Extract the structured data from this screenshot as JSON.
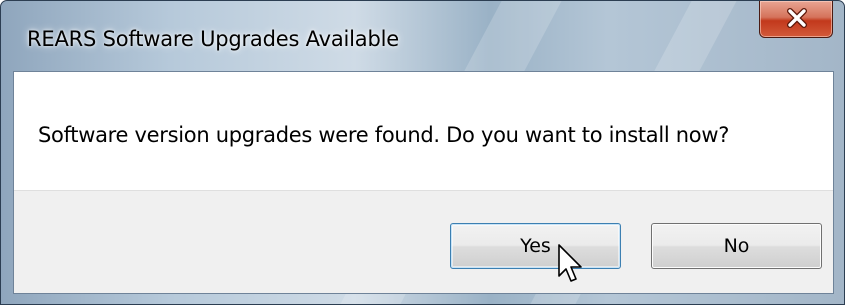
{
  "window": {
    "title": "REARS Software Upgrades Available"
  },
  "title_bar": {
    "close_icon": "close-icon",
    "close_button_color": "#c94a2c"
  },
  "dialog": {
    "message": "Software version upgrades were found.  Do you want to install now?",
    "buttons": {
      "yes_label": "Yes",
      "no_label": "No"
    }
  },
  "pointer": {
    "icon": "arrow-cursor-icon",
    "hovering": "yes-button"
  }
}
